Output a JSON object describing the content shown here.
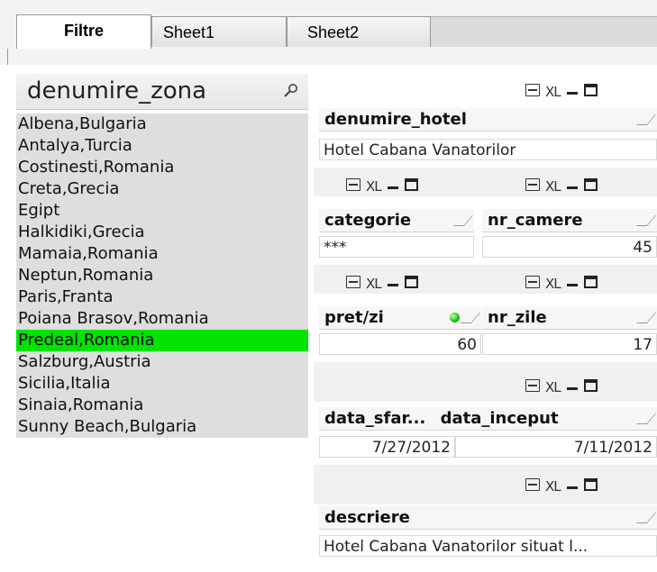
{
  "tabs": [
    {
      "label": "Filtre",
      "active": true
    },
    {
      "label": "Sheet1",
      "active": false
    },
    {
      "label": "Sheet2",
      "active": false
    }
  ],
  "zona": {
    "title": "denumire_zona",
    "items": [
      "Albena,Bulgaria",
      "Antalya,Turcia",
      "Costinesti,Romania",
      "Creta,Grecia",
      "Egipt",
      "Halkidiki,Grecia",
      "Mamaia,Romania",
      "Neptun,Romania",
      "Paris,Franta",
      "Poiana Brasov,Romania",
      "Predeal,Romania",
      "Salzburg,Austria",
      "Sicilia,Italia",
      "Sinaia,Romania",
      "Sunny Beach,Bulgaria"
    ],
    "selected_index": 10,
    "selected_color": "#00e400"
  },
  "icon_xl": "XL",
  "hotel": {
    "header": "denumire_hotel",
    "value": "Hotel Cabana Vanatorilor"
  },
  "categorie": {
    "header": "categorie",
    "value": "***"
  },
  "nr_camere": {
    "header": "nr_camere",
    "value": "45"
  },
  "pret": {
    "header": "pret/zi",
    "value": "60"
  },
  "nr_zile": {
    "header": "nr_zile",
    "value": "17"
  },
  "data_sfarsit": {
    "header": "data_sfar...",
    "value": "7/27/2012"
  },
  "data_inceput": {
    "header": "data_inceput",
    "value": "7/11/2012"
  },
  "descriere": {
    "header": "descriere",
    "value": "Hotel Cabana Vanatorilor situat l..."
  }
}
